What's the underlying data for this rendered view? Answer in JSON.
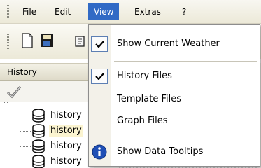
{
  "menubar": {
    "items": [
      {
        "label": "File"
      },
      {
        "label": "Edit"
      },
      {
        "label": "View"
      },
      {
        "label": "Extras"
      },
      {
        "label": "?"
      }
    ],
    "active": "View"
  },
  "panel": {
    "title": "History",
    "tree": [
      {
        "label": "history",
        "icon": "database-icon"
      },
      {
        "label": "history",
        "icon": "database-icon"
      },
      {
        "label": "history",
        "icon": "database-icon"
      },
      {
        "label": "history",
        "icon": "database-icon"
      }
    ]
  },
  "view_menu": {
    "items": [
      {
        "label": "Show Current Weather",
        "checked": true
      },
      {
        "label": "History Files",
        "checked": true
      },
      {
        "label": "Template Files",
        "checked": false
      },
      {
        "label": "Graph Files",
        "checked": false
      },
      {
        "label": "Show Data Tooltips",
        "icon": "info-icon"
      }
    ]
  },
  "colors": {
    "menu_highlight": "#316ac5",
    "checkbox_border": "#5d7fb3",
    "info_icon": "#1f4fb5"
  }
}
